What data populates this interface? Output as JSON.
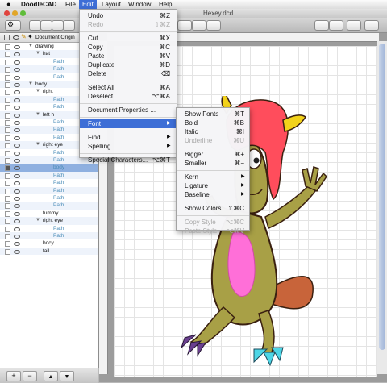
{
  "menubar": {
    "app_name": "DoodleCAD",
    "items": [
      {
        "label": "File"
      },
      {
        "label": "Edit",
        "active": true
      },
      {
        "label": "Layout"
      },
      {
        "label": "Window"
      },
      {
        "label": "Help"
      }
    ]
  },
  "window": {
    "title": "Hexey.dcd"
  },
  "sidebar": {
    "header_label": "Document Origin",
    "rows": [
      {
        "label": "drawing",
        "indent": 0,
        "kind": "group",
        "open": true
      },
      {
        "label": "hat",
        "indent": 1,
        "kind": "group",
        "open": true
      },
      {
        "label": "Path",
        "indent": 2,
        "kind": "path"
      },
      {
        "label": "Path",
        "indent": 2,
        "kind": "path"
      },
      {
        "label": "Path",
        "indent": 2,
        "kind": "path"
      },
      {
        "label": "body",
        "indent": 0,
        "kind": "group",
        "open": true
      },
      {
        "label": "right",
        "indent": 1,
        "kind": "group",
        "open": true
      },
      {
        "label": "Path",
        "indent": 2,
        "kind": "path"
      },
      {
        "label": "Path",
        "indent": 2,
        "kind": "path"
      },
      {
        "label": "left h",
        "indent": 1,
        "kind": "group",
        "open": true
      },
      {
        "label": "Path",
        "indent": 2,
        "kind": "path"
      },
      {
        "label": "Path",
        "indent": 2,
        "kind": "path"
      },
      {
        "label": "Path",
        "indent": 2,
        "kind": "path"
      },
      {
        "label": "right eye",
        "indent": 1,
        "kind": "group",
        "open": true
      },
      {
        "label": "Path",
        "indent": 2,
        "kind": "path"
      },
      {
        "label": "Path",
        "indent": 2,
        "kind": "path"
      },
      {
        "label": "body",
        "indent": 2,
        "kind": "path",
        "selected": true,
        "locked": true
      },
      {
        "label": "Path",
        "indent": 2,
        "kind": "path"
      },
      {
        "label": "Path",
        "indent": 2,
        "kind": "path"
      },
      {
        "label": "Path",
        "indent": 2,
        "kind": "path"
      },
      {
        "label": "Path",
        "indent": 2,
        "kind": "path"
      },
      {
        "label": "Path",
        "indent": 2,
        "kind": "path"
      },
      {
        "label": "tummy",
        "indent": 1,
        "kind": "plain"
      },
      {
        "label": "right eye",
        "indent": 1,
        "kind": "group",
        "open": true
      },
      {
        "label": "Path",
        "indent": 2,
        "kind": "path"
      },
      {
        "label": "Path",
        "indent": 2,
        "kind": "path"
      },
      {
        "label": "bocy",
        "indent": 1,
        "kind": "plain"
      },
      {
        "label": "tail",
        "indent": 1,
        "kind": "plain"
      }
    ],
    "footer_buttons": [
      "+",
      "−"
    ]
  },
  "edit_menu": {
    "items": [
      {
        "label": "Undo",
        "shortcut": "⌘Z"
      },
      {
        "label": "Redo",
        "shortcut": "⇧⌘Z",
        "disabled": true
      },
      {
        "separator": true
      },
      {
        "label": "Cut",
        "shortcut": "⌘X"
      },
      {
        "label": "Copy",
        "shortcut": "⌘C"
      },
      {
        "label": "Paste",
        "shortcut": "⌘V"
      },
      {
        "label": "Duplicate",
        "shortcut": "⌘D"
      },
      {
        "label": "Delete",
        "shortcut": "⌫"
      },
      {
        "separator": true
      },
      {
        "label": "Select All",
        "shortcut": "⌘A"
      },
      {
        "label": "Deselect",
        "shortcut": "⌥⌘A"
      },
      {
        "separator": true
      },
      {
        "label": "Document Properties ...",
        "shortcut": ""
      },
      {
        "separator": true
      },
      {
        "label": "Font",
        "shortcut": "",
        "submenu": true,
        "highlighted": true
      },
      {
        "separator": true
      },
      {
        "label": "Find",
        "shortcut": "",
        "submenu": true
      },
      {
        "label": "Spelling",
        "shortcut": "",
        "submenu": true
      },
      {
        "separator": true
      },
      {
        "label": "Special Characters...",
        "shortcut": "⌥⌘T"
      }
    ]
  },
  "font_menu": {
    "items": [
      {
        "label": "Show Fonts",
        "shortcut": "⌘T"
      },
      {
        "label": "Bold",
        "shortcut": "⌘B"
      },
      {
        "label": "Italic",
        "shortcut": "⌘I"
      },
      {
        "label": "Underline",
        "shortcut": "⌘U",
        "disabled": true
      },
      {
        "separator": true
      },
      {
        "label": "Bigger",
        "shortcut": "⌘+"
      },
      {
        "label": "Smaller",
        "shortcut": "⌘−"
      },
      {
        "separator": true
      },
      {
        "label": "Kern",
        "shortcut": "",
        "submenu": true
      },
      {
        "label": "Ligature",
        "shortcut": "",
        "submenu": true
      },
      {
        "label": "Baseline",
        "shortcut": "",
        "submenu": true
      },
      {
        "separator": true
      },
      {
        "label": "Show Colors",
        "shortcut": "⇧⌘C"
      },
      {
        "separator": true
      },
      {
        "label": "Copy Style",
        "shortcut": "⌥⌘C",
        "disabled": true
      },
      {
        "label": "Paste Style",
        "shortcut": "⌥⌘V",
        "disabled": true
      }
    ]
  },
  "colors": {
    "accent": "#3d6ed6",
    "creature_body": "#a8a046",
    "creature_belly": "#ff6fd8",
    "hat": "#ff4d5c",
    "horns": "#f2d21a",
    "tail": "#c8643a",
    "claws_left": "#6a3f8f",
    "claws_right": "#4cd6e6"
  }
}
